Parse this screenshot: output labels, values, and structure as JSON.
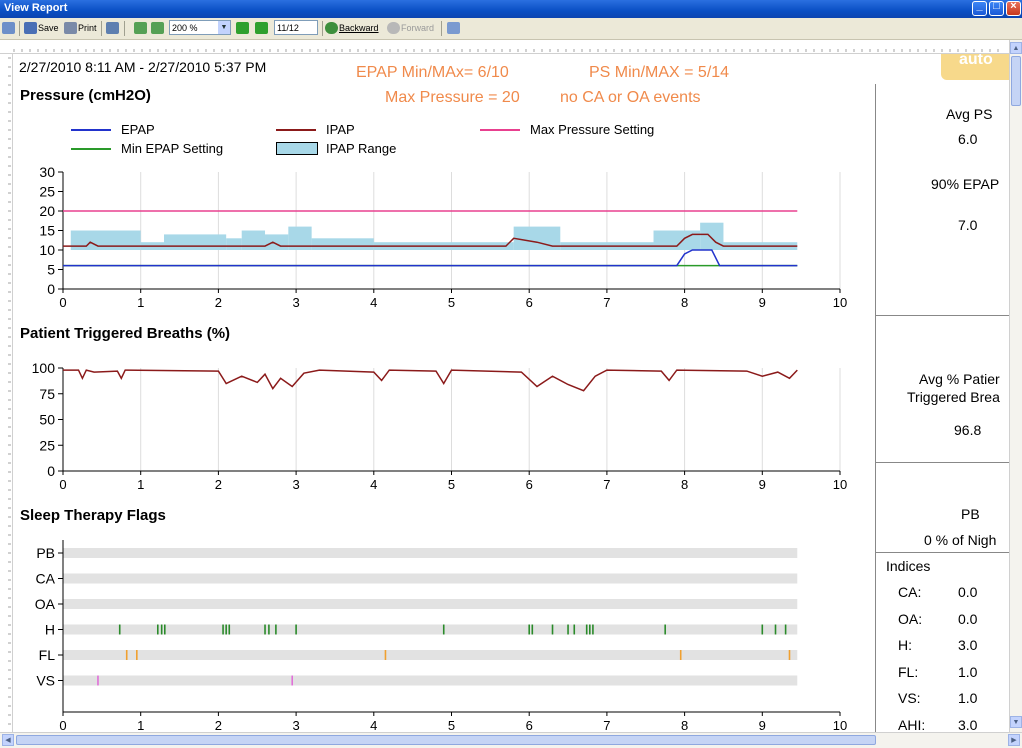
{
  "window": {
    "title": "View Report"
  },
  "toolbar": {
    "save_label": "Save",
    "print_label": "Print",
    "zoom_value": "200 %",
    "page_value": "11/12",
    "backward_label": "Backward",
    "forward_label": "Forward"
  },
  "report": {
    "date_range": "2/27/2010 8:11 AM - 2/27/2010 5:37 PM",
    "note_line1a": "EPAP Min/MAx= 6/10",
    "note_line1b": "PS Min/MAX = 5/14",
    "note_line2a": "Max Pressure = 20",
    "note_line2b": "no CA or OA events",
    "logo_text": "auto",
    "pressure_title": "Pressure (cmH2O)",
    "triggered_title": "Patient Triggered Breaths (%)",
    "flags_title": "Sleep Therapy Flags",
    "legend": {
      "epap": "EPAP",
      "ipap": "IPAP",
      "max_pressure": "Max Pressure Setting",
      "min_epap": "Min EPAP Setting",
      "ipap_range": "IPAP Range"
    }
  },
  "colors": {
    "epap": "#2233cc",
    "ipap": "#8b1a1a",
    "max_pressure": "#e8408f",
    "min_epap": "#2a9a2a",
    "ipap_range": "#a8d8e8",
    "note": "#f08a4b"
  },
  "right_panel": {
    "avg_ps_label": "Avg PS",
    "avg_ps_value": "6.0",
    "epap90_label": "90% EPAP",
    "epap90_value": "7.0",
    "avg_trig_label1": "Avg % Patier",
    "avg_trig_label2": "Triggered Brea",
    "avg_trig_value": "96.8",
    "pb_label": "PB",
    "pb_value": "0 % of Nigh",
    "indices_label": "Indices",
    "indices": [
      {
        "name": "CA:",
        "value": "0.0"
      },
      {
        "name": "OA:",
        "value": "0.0"
      },
      {
        "name": "H:",
        "value": "3.0"
      },
      {
        "name": "FL:",
        "value": "1.0"
      },
      {
        "name": "VS:",
        "value": "1.0"
      },
      {
        "name": "AHI:",
        "value": "3.0"
      }
    ]
  },
  "chart_data": [
    {
      "type": "line",
      "title": "Pressure (cmH2O)",
      "xlim": [
        0,
        10
      ],
      "ylim": [
        0,
        30
      ],
      "x_ticks": [
        "0",
        "1",
        "2",
        "3",
        "4",
        "5",
        "6",
        "7",
        "8",
        "9",
        "10"
      ],
      "y_ticks": [
        "0",
        "5",
        "10",
        "15",
        "20",
        "25",
        "30"
      ],
      "series": [
        {
          "name": "Max Pressure Setting",
          "points": [
            [
              0,
              20
            ],
            [
              9.45,
              20
            ]
          ]
        },
        {
          "name": "Min EPAP Setting",
          "points": [
            [
              0,
              6
            ],
            [
              9.45,
              6
            ]
          ]
        },
        {
          "name": "IPAP",
          "points": [
            [
              0,
              11
            ],
            [
              0.3,
              11
            ],
            [
              0.35,
              12
            ],
            [
              0.45,
              11
            ],
            [
              1.5,
              11
            ],
            [
              2.6,
              11
            ],
            [
              2.7,
              12
            ],
            [
              2.8,
              11
            ],
            [
              3.4,
              11
            ],
            [
              5.7,
              11
            ],
            [
              5.8,
              13
            ],
            [
              6.1,
              12
            ],
            [
              6.3,
              11
            ],
            [
              7.9,
              11
            ],
            [
              8.0,
              13
            ],
            [
              8.1,
              14
            ],
            [
              8.3,
              14
            ],
            [
              8.4,
              12
            ],
            [
              8.5,
              11
            ],
            [
              9.45,
              11
            ]
          ]
        },
        {
          "name": "EPAP",
          "points": [
            [
              0,
              6
            ],
            [
              7.9,
              6
            ],
            [
              8.0,
              9
            ],
            [
              8.1,
              10
            ],
            [
              8.35,
              10
            ],
            [
              8.45,
              6
            ],
            [
              9.45,
              6
            ]
          ]
        },
        {
          "name": "IPAP Range",
          "points": [
            [
              0,
              10
            ],
            [
              0.1,
              15
            ],
            [
              1.0,
              12
            ],
            [
              1.3,
              14
            ],
            [
              2.1,
              13
            ],
            [
              2.3,
              15
            ],
            [
              2.6,
              14
            ],
            [
              2.9,
              16
            ],
            [
              3.2,
              13
            ],
            [
              4.0,
              12
            ],
            [
              5.8,
              16
            ],
            [
              6.4,
              12
            ],
            [
              7.6,
              15
            ],
            [
              8.2,
              17
            ],
            [
              8.5,
              12
            ],
            [
              9.45,
              11
            ]
          ]
        }
      ]
    },
    {
      "type": "line",
      "title": "Patient Triggered Breaths (%)",
      "xlim": [
        0,
        10
      ],
      "ylim": [
        0,
        100
      ],
      "x_ticks": [
        "0",
        "1",
        "2",
        "3",
        "4",
        "5",
        "6",
        "7",
        "8",
        "9",
        "10"
      ],
      "y_ticks": [
        "0",
        "25",
        "50",
        "75",
        "100"
      ],
      "series": [
        {
          "name": "Patient Triggered Breaths",
          "points": [
            [
              0,
              98
            ],
            [
              0.2,
              98
            ],
            [
              0.25,
              90
            ],
            [
              0.3,
              98
            ],
            [
              0.4,
              96
            ],
            [
              0.7,
              97
            ],
            [
              0.75,
              90
            ],
            [
              0.8,
              98
            ],
            [
              2.0,
              97
            ],
            [
              2.1,
              85
            ],
            [
              2.3,
              92
            ],
            [
              2.5,
              86
            ],
            [
              2.6,
              94
            ],
            [
              2.7,
              80
            ],
            [
              2.8,
              90
            ],
            [
              2.95,
              82
            ],
            [
              3.1,
              95
            ],
            [
              3.3,
              98
            ],
            [
              4.0,
              96
            ],
            [
              4.1,
              88
            ],
            [
              4.2,
              98
            ],
            [
              4.8,
              97
            ],
            [
              4.9,
              85
            ],
            [
              5.0,
              98
            ],
            [
              5.9,
              96
            ],
            [
              6.1,
              82
            ],
            [
              6.3,
              92
            ],
            [
              6.5,
              84
            ],
            [
              6.7,
              78
            ],
            [
              6.85,
              92
            ],
            [
              7.0,
              98
            ],
            [
              7.7,
              97
            ],
            [
              7.8,
              88
            ],
            [
              7.9,
              98
            ],
            [
              8.8,
              97
            ],
            [
              9.0,
              92
            ],
            [
              9.2,
              96
            ],
            [
              9.35,
              90
            ],
            [
              9.45,
              98
            ]
          ]
        }
      ]
    },
    {
      "type": "scatter",
      "title": "Sleep Therapy Flags",
      "xlim": [
        0,
        10
      ],
      "categories": [
        "PB",
        "CA",
        "OA",
        "H",
        "FL",
        "VS"
      ],
      "x_ticks": [
        "0",
        "1",
        "2",
        "3",
        "4",
        "5",
        "6",
        "7",
        "8",
        "9",
        "10"
      ],
      "series": [
        {
          "name": "PB",
          "x": []
        },
        {
          "name": "CA",
          "x": []
        },
        {
          "name": "OA",
          "x": []
        },
        {
          "name": "H",
          "x": [
            0.73,
            1.22,
            1.27,
            1.31,
            2.06,
            2.1,
            2.14,
            2.6,
            2.65,
            2.74,
            3.0,
            4.9,
            6.0,
            6.04,
            6.3,
            6.5,
            6.58,
            6.74,
            6.78,
            6.82,
            7.75,
            9.0,
            9.17,
            9.3
          ]
        },
        {
          "name": "FL",
          "x": [
            0.82,
            0.95,
            4.15,
            7.95,
            9.35
          ]
        },
        {
          "name": "VS",
          "x": [
            0.45,
            2.95
          ]
        }
      ]
    }
  ]
}
